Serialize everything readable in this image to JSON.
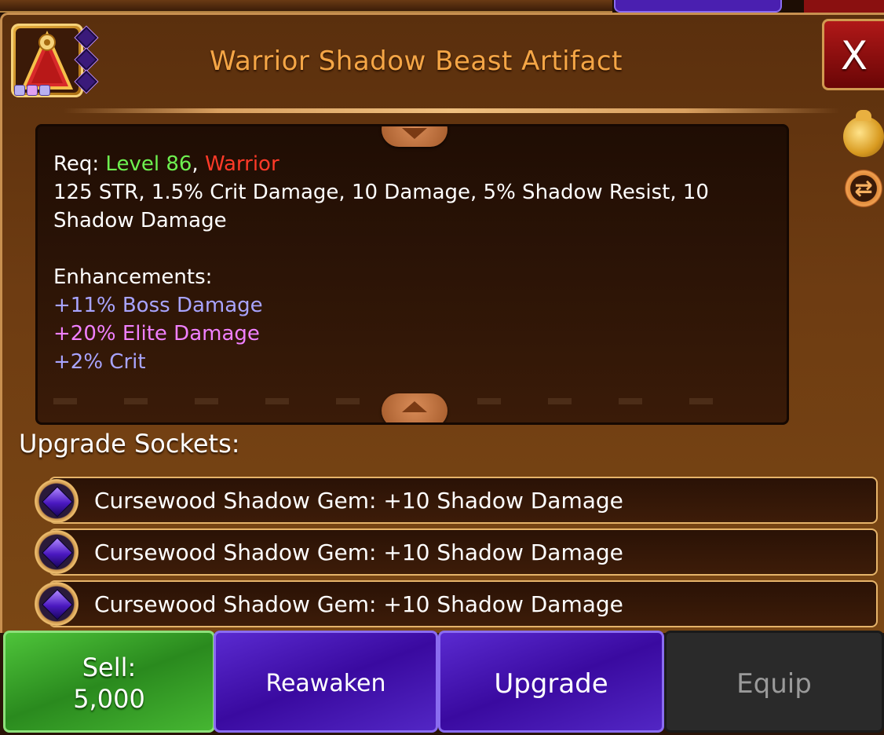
{
  "item": {
    "title": "Warrior Shadow Beast Artifact",
    "icon": "artifact-pyramid-icon"
  },
  "close_label": "X",
  "stats": {
    "req_prefix": "Req: ",
    "req_level": "Level 86",
    "req_sep": ", ",
    "req_class": "Warrior",
    "base_line": "125 STR, 1.5% Crit Damage, 10 Damage, 5% Shadow Resist, 10 Shadow Damage",
    "enhancements_heading": "Enhancements:",
    "enhancements": [
      {
        "text": "+11% Boss Damage",
        "color": "#a8a4ff"
      },
      {
        "text": "+20% Elite Damage",
        "color": "#f080ff"
      },
      {
        "text": "+2% Crit",
        "color": "#a8a4ff"
      }
    ]
  },
  "sockets": {
    "heading": "Upgrade Sockets:",
    "items": [
      {
        "text": "Cursewood Shadow Gem: +10 Shadow Damage",
        "icon": "shadow-gem-icon"
      },
      {
        "text": "Cursewood Shadow Gem: +10 Shadow Damage",
        "icon": "shadow-gem-icon"
      },
      {
        "text": "Cursewood Shadow Gem: +10 Shadow Damage",
        "icon": "shadow-gem-icon"
      }
    ]
  },
  "side_icons": {
    "money": "money-bag-icon",
    "swap": "swap-arrows-icon",
    "swap_glyph": "⇄"
  },
  "buttons": {
    "sell_label": "Sell:",
    "sell_price": "5,000",
    "reawaken": "Reawaken",
    "upgrade": "Upgrade",
    "equip": "Equip"
  },
  "colors": {
    "title": "#f5a646",
    "level": "#6ef050",
    "class": "#ff3a28",
    "sell": "#3aa82a",
    "purple_button": "#4a18b8",
    "equip_disabled": "#2a2a2a"
  }
}
